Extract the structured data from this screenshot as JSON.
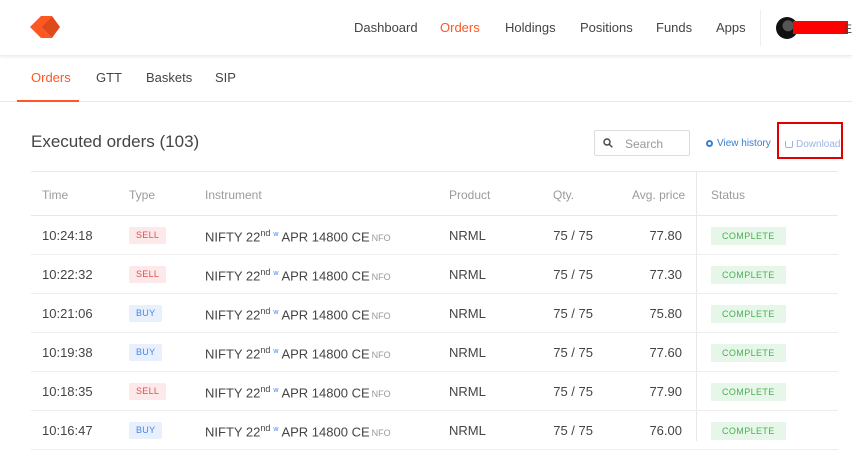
{
  "nav": {
    "items": [
      "Dashboard",
      "Orders",
      "Holdings",
      "Positions",
      "Funds",
      "Apps"
    ],
    "active": "Orders",
    "user_tail": "E"
  },
  "subtabs": {
    "items": [
      "Orders",
      "GTT",
      "Baskets",
      "SIP"
    ],
    "active": "Orders"
  },
  "section": {
    "title": "Executed orders (103)",
    "search_placeholder": "Search",
    "view_history": "View history",
    "download": "Download"
  },
  "table": {
    "headers": [
      "Time",
      "Type",
      "Instrument",
      "Product",
      "Qty.",
      "Avg. price",
      "Status"
    ],
    "rows": [
      {
        "time": "10:24:18",
        "type": "SELL",
        "inst_a": "NIFTY 22",
        "inst_sup": "nd",
        "inst_b": "APR 14800 CE",
        "exch": "NFO",
        "product": "NRML",
        "qty": "75 / 75",
        "avg": "77.80",
        "status": "COMPLETE"
      },
      {
        "time": "10:22:32",
        "type": "SELL",
        "inst_a": "NIFTY 22",
        "inst_sup": "nd",
        "inst_b": "APR 14800 CE",
        "exch": "NFO",
        "product": "NRML",
        "qty": "75 / 75",
        "avg": "77.30",
        "status": "COMPLETE"
      },
      {
        "time": "10:21:06",
        "type": "BUY",
        "inst_a": "NIFTY 22",
        "inst_sup": "nd",
        "inst_b": "APR 14800 CE",
        "exch": "NFO",
        "product": "NRML",
        "qty": "75 / 75",
        "avg": "75.80",
        "status": "COMPLETE"
      },
      {
        "time": "10:19:38",
        "type": "BUY",
        "inst_a": "NIFTY 22",
        "inst_sup": "nd",
        "inst_b": "APR 14800 CE",
        "exch": "NFO",
        "product": "NRML",
        "qty": "75 / 75",
        "avg": "77.60",
        "status": "COMPLETE"
      },
      {
        "time": "10:18:35",
        "type": "SELL",
        "inst_a": "NIFTY 22",
        "inst_sup": "nd",
        "inst_b": "APR 14800 CE",
        "exch": "NFO",
        "product": "NRML",
        "qty": "75 / 75",
        "avg": "77.90",
        "status": "COMPLETE"
      },
      {
        "time": "10:16:47",
        "type": "BUY",
        "inst_a": "NIFTY 22",
        "inst_sup": "nd",
        "inst_b": "APR 14800 CE",
        "exch": "NFO",
        "product": "NRML",
        "qty": "75 / 75",
        "avg": "76.00",
        "status": "COMPLETE"
      }
    ],
    "weekly_icon": "w"
  },
  "colors": {
    "accent": "#ff5722",
    "link": "#387ed1",
    "sell": "#e05050",
    "buy": "#4184f3",
    "complete": "#4caf50",
    "highlight_box": "#e00000"
  },
  "icons": [
    "kite-logo",
    "avatar",
    "search-icon",
    "history-icon",
    "download-icon",
    "weekly-icon"
  ]
}
